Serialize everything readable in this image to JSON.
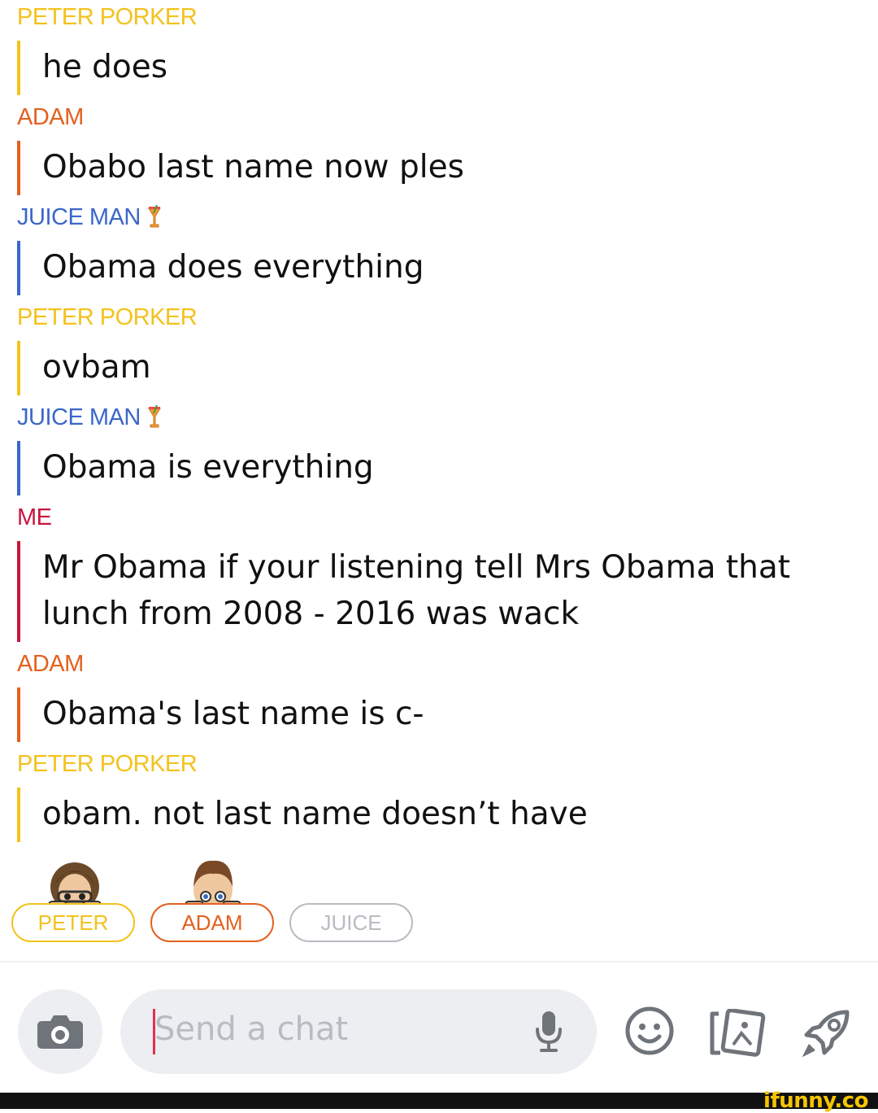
{
  "colors": {
    "peter": "#f3c21c",
    "adam": "#e2611f",
    "juice": "#3b67c9",
    "me": "#c8163e",
    "text": "#111111",
    "icon": "#6f747b",
    "juice_pill": "#b8bcc2",
    "ifunny": "#f6c500"
  },
  "messages": [
    {
      "sender": "PETER PORKER",
      "color_key": "peter",
      "emoji": false,
      "text": "he does"
    },
    {
      "sender": "ADAM",
      "color_key": "adam",
      "emoji": false,
      "text": "Obabo last name now ples"
    },
    {
      "sender": "JUICE MAN",
      "color_key": "juice",
      "emoji": true,
      "text": "Obama does everything"
    },
    {
      "sender": "PETER PORKER",
      "color_key": "peter",
      "emoji": false,
      "text": "ovbam"
    },
    {
      "sender": "JUICE MAN",
      "color_key": "juice",
      "emoji": true,
      "text": "Obama is everything"
    },
    {
      "sender": "ME",
      "color_key": "me",
      "emoji": false,
      "text": "Mr Obama if your listening tell Mrs Obama that lunch from 2008 - 2016 was wack"
    },
    {
      "sender": "ADAM",
      "color_key": "adam",
      "emoji": false,
      "text": "Obama's last name is c-"
    },
    {
      "sender": "PETER PORKER",
      "color_key": "peter",
      "emoji": false,
      "text": "obam. not last name doesn’t have"
    }
  ],
  "participants": [
    {
      "label": "PETER",
      "color_key": "peter"
    },
    {
      "label": "ADAM",
      "color_key": "adam"
    },
    {
      "label": "JUICE",
      "color_key": "juice_pill"
    }
  ],
  "composer": {
    "placeholder": "Send a chat"
  },
  "icons": {
    "camera": "camera-icon",
    "mic": "microphone-icon",
    "emoji": "smiley-icon",
    "memories": "cards-icon",
    "games": "rocket-icon",
    "drink": "tropical-drink-icon"
  },
  "watermark": "ifunny.co"
}
